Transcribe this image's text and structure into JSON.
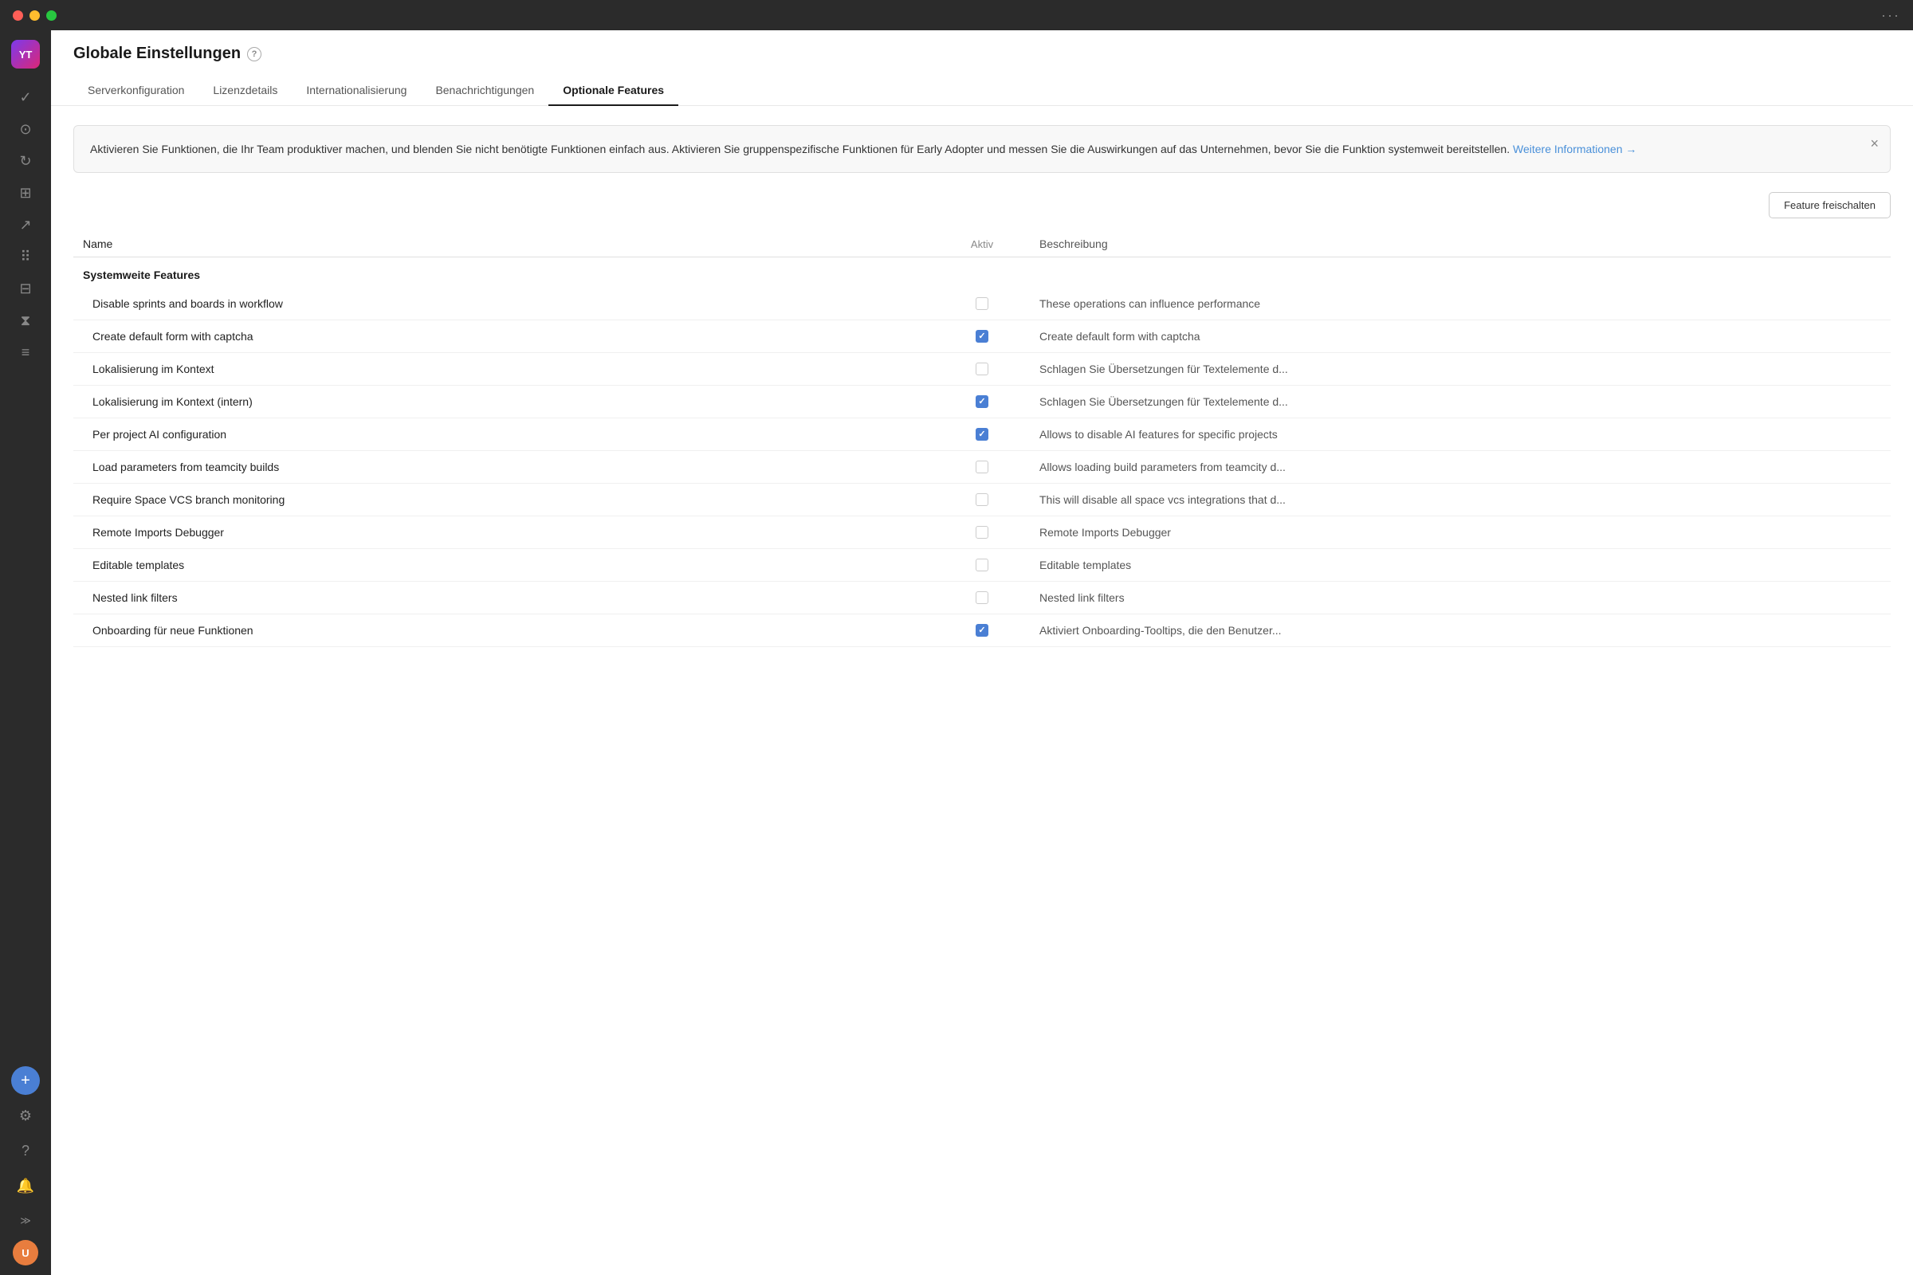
{
  "titlebar": {
    "dots_label": "···"
  },
  "sidebar": {
    "logo_text": "YT",
    "icons": [
      {
        "name": "check-icon",
        "symbol": "✓",
        "active": false
      },
      {
        "name": "settings-circle-icon",
        "symbol": "⊙",
        "active": false
      },
      {
        "name": "refresh-icon",
        "symbol": "↻",
        "active": false
      },
      {
        "name": "layout-icon",
        "symbol": "⊞",
        "active": false
      },
      {
        "name": "chart-icon",
        "symbol": "↗",
        "active": false
      },
      {
        "name": "apps-icon",
        "symbol": "⠿",
        "active": false
      },
      {
        "name": "book-icon",
        "symbol": "⊟",
        "active": false
      },
      {
        "name": "timer-icon",
        "symbol": "⧗",
        "active": false
      },
      {
        "name": "layers-icon",
        "symbol": "≡",
        "active": false
      }
    ],
    "bottom_icons": [
      {
        "name": "add-icon",
        "symbol": "+"
      },
      {
        "name": "gear-icon",
        "symbol": "⚙"
      },
      {
        "name": "help-icon",
        "symbol": "?"
      },
      {
        "name": "bell-icon",
        "symbol": "🔔"
      },
      {
        "name": "expand-icon",
        "symbol": "≫"
      }
    ],
    "avatar_text": "U"
  },
  "header": {
    "title": "Globale Einstellungen",
    "tabs": [
      {
        "id": "serverkonfiguration",
        "label": "Serverkonfiguration",
        "active": false
      },
      {
        "id": "lizenzdetails",
        "label": "Lizenzdetails",
        "active": false
      },
      {
        "id": "internationalisierung",
        "label": "Internationalisierung",
        "active": false
      },
      {
        "id": "benachrichtigungen",
        "label": "Benachrichtigungen",
        "active": false
      },
      {
        "id": "optionale-features",
        "label": "Optionale Features",
        "active": true
      }
    ]
  },
  "info_banner": {
    "text": "Aktivieren Sie Funktionen, die Ihr Team produktiver machen, und blenden Sie nicht benötigte Funktionen einfach aus. Aktivieren Sie gruppenspezifische Funktionen für Early Adopter und messen Sie die Auswirkungen auf das Unternehmen, bevor Sie die Funktion systemweit bereitstellen.",
    "link_text": "Weitere Informationen →",
    "link_href": "#"
  },
  "action_bar": {
    "unlock_button": "Feature freischalten"
  },
  "table": {
    "columns": {
      "name": "Name",
      "active": "Aktiv",
      "description": "Beschreibung"
    },
    "section_label": "Systemweite Features",
    "rows": [
      {
        "name": "Disable sprints and boards in workflow",
        "checked": false,
        "description": "These operations can influence performance"
      },
      {
        "name": "Create default form with captcha",
        "checked": true,
        "description": "Create default form with captcha"
      },
      {
        "name": "Lokalisierung im Kontext",
        "checked": false,
        "description": "Schlagen Sie Übersetzungen für Textelemente d..."
      },
      {
        "name": "Lokalisierung im Kontext (intern)",
        "checked": true,
        "description": "Schlagen Sie Übersetzungen für Textelemente d..."
      },
      {
        "name": "Per project AI configuration",
        "checked": true,
        "description": "Allows to disable AI features for specific projects"
      },
      {
        "name": "Load parameters from teamcity builds",
        "checked": false,
        "description": "Allows loading build parameters from teamcity d..."
      },
      {
        "name": "Require Space VCS branch monitoring",
        "checked": false,
        "description": "This will disable all space vcs integrations that d..."
      },
      {
        "name": "Remote Imports Debugger",
        "checked": false,
        "description": "Remote Imports Debugger"
      },
      {
        "name": "Editable templates",
        "checked": false,
        "description": "Editable templates"
      },
      {
        "name": "Nested link filters",
        "checked": false,
        "description": "Nested link filters"
      },
      {
        "name": "Onboarding für neue Funktionen",
        "checked": true,
        "description": "Aktiviert Onboarding-Tooltips, die den Benutzer..."
      }
    ]
  }
}
